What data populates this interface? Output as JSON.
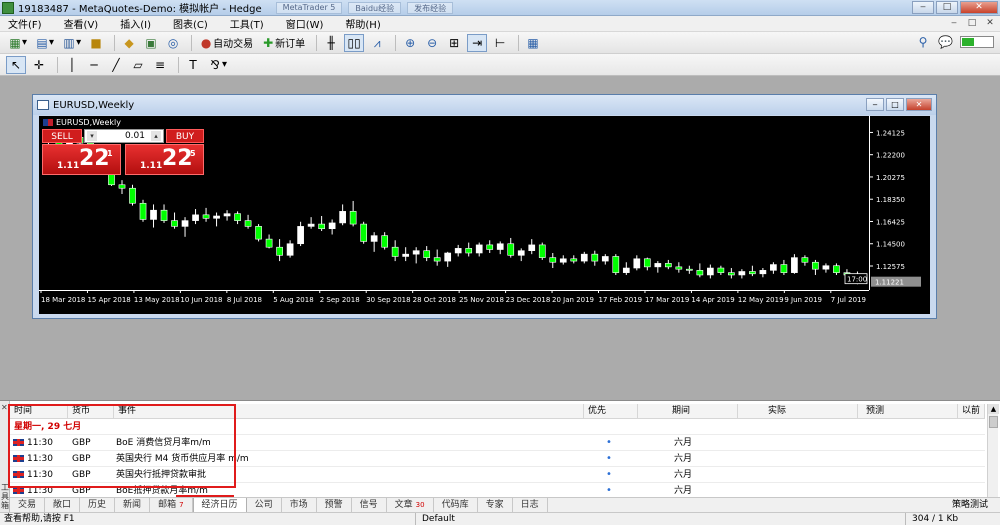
{
  "window": {
    "title": "19183487 - MetaQuotes-Demo: 模拟帐户 - Hedge",
    "background_tabs": [
      "MetaTrader 5",
      "Baidu经验",
      "发布经验"
    ],
    "btn_min": "‒",
    "btn_max": "□",
    "btn_close": "✕"
  },
  "menu": [
    "文件(F)",
    "查看(V)",
    "插入(I)",
    "图表(C)",
    "工具(T)",
    "窗口(W)",
    "帮助(H)"
  ],
  "toolbar": {
    "autotrade_label": "自动交易",
    "new_order_label": "新订单"
  },
  "chart_window": {
    "title": "EURUSD,Weekly",
    "inner_label": "EURUSD,Weekly"
  },
  "trade_panel": {
    "sell_label": "SELL",
    "buy_label": "BUY",
    "lot_value": "0.01",
    "sell_price_prefix": "1.11",
    "sell_price_big": "22",
    "sell_price_sup": "1",
    "buy_price_prefix": "1.11",
    "buy_price_big": "22",
    "buy_price_sup": "5"
  },
  "chart_data": {
    "type": "candlestick",
    "symbol": "EURUSD",
    "timeframe": "Weekly",
    "ylim": [
      1.105,
      1.252
    ],
    "y_ticks": [
      "1.24125",
      "1.22200",
      "1.20275",
      "1.18350",
      "1.16425",
      "1.14500",
      "1.12575"
    ],
    "y_tick_values": [
      1.24125,
      1.222,
      1.20275,
      1.1835,
      1.16425,
      1.145,
      1.12575
    ],
    "x_ticks": [
      "18 Mar 2018",
      "15 Apr 2018",
      "13 May 2018",
      "10 Jun 2018",
      "8 Jul 2018",
      "5 Aug 2018",
      "2 Sep 2018",
      "30 Sep 2018",
      "28 Oct 2018",
      "25 Nov 2018",
      "23 Dec 2018",
      "20 Jan 2019",
      "17 Feb 2019",
      "17 Mar 2019",
      "14 Apr 2019",
      "12 May 2019",
      "9 Jun 2019",
      "7 Jul 2019"
    ],
    "current_price": "1.11221",
    "time_label": "17:00",
    "candles": [
      {
        "o": 1.233,
        "h": 1.241,
        "l": 1.229,
        "c": 1.235
      },
      {
        "o": 1.235,
        "h": 1.24,
        "l": 1.228,
        "c": 1.23
      },
      {
        "o": 1.23,
        "h": 1.239,
        "l": 1.225,
        "c": 1.237
      },
      {
        "o": 1.237,
        "h": 1.242,
        "l": 1.23,
        "c": 1.232
      },
      {
        "o": 1.232,
        "h": 1.236,
        "l": 1.22,
        "c": 1.227
      },
      {
        "o": 1.227,
        "h": 1.23,
        "l": 1.21,
        "c": 1.212
      },
      {
        "o": 1.212,
        "h": 1.215,
        "l": 1.195,
        "c": 1.196
      },
      {
        "o": 1.196,
        "h": 1.2,
        "l": 1.188,
        "c": 1.193
      },
      {
        "o": 1.193,
        "h": 1.196,
        "l": 1.178,
        "c": 1.18
      },
      {
        "o": 1.18,
        "h": 1.183,
        "l": 1.164,
        "c": 1.166
      },
      {
        "o": 1.166,
        "h": 1.179,
        "l": 1.159,
        "c": 1.174
      },
      {
        "o": 1.174,
        "h": 1.179,
        "l": 1.163,
        "c": 1.165
      },
      {
        "o": 1.165,
        "h": 1.172,
        "l": 1.158,
        "c": 1.16
      },
      {
        "o": 1.16,
        "h": 1.168,
        "l": 1.151,
        "c": 1.165
      },
      {
        "o": 1.165,
        "h": 1.175,
        "l": 1.162,
        "c": 1.17
      },
      {
        "o": 1.17,
        "h": 1.176,
        "l": 1.164,
        "c": 1.167
      },
      {
        "o": 1.167,
        "h": 1.172,
        "l": 1.16,
        "c": 1.169
      },
      {
        "o": 1.169,
        "h": 1.174,
        "l": 1.165,
        "c": 1.171
      },
      {
        "o": 1.171,
        "h": 1.173,
        "l": 1.162,
        "c": 1.165
      },
      {
        "o": 1.165,
        "h": 1.17,
        "l": 1.158,
        "c": 1.16
      },
      {
        "o": 1.16,
        "h": 1.162,
        "l": 1.147,
        "c": 1.149
      },
      {
        "o": 1.149,
        "h": 1.153,
        "l": 1.141,
        "c": 1.142
      },
      {
        "o": 1.142,
        "h": 1.149,
        "l": 1.13,
        "c": 1.135
      },
      {
        "o": 1.135,
        "h": 1.148,
        "l": 1.133,
        "c": 1.145
      },
      {
        "o": 1.145,
        "h": 1.164,
        "l": 1.143,
        "c": 1.16
      },
      {
        "o": 1.16,
        "h": 1.168,
        "l": 1.158,
        "c": 1.162
      },
      {
        "o": 1.162,
        "h": 1.169,
        "l": 1.156,
        "c": 1.158
      },
      {
        "o": 1.158,
        "h": 1.166,
        "l": 1.153,
        "c": 1.163
      },
      {
        "o": 1.163,
        "h": 1.179,
        "l": 1.161,
        "c": 1.173
      },
      {
        "o": 1.173,
        "h": 1.182,
        "l": 1.16,
        "c": 1.162
      },
      {
        "o": 1.162,
        "h": 1.164,
        "l": 1.145,
        "c": 1.147
      },
      {
        "o": 1.147,
        "h": 1.155,
        "l": 1.138,
        "c": 1.152
      },
      {
        "o": 1.152,
        "h": 1.155,
        "l": 1.14,
        "c": 1.142
      },
      {
        "o": 1.142,
        "h": 1.148,
        "l": 1.13,
        "c": 1.134
      },
      {
        "o": 1.134,
        "h": 1.142,
        "l": 1.13,
        "c": 1.136
      },
      {
        "o": 1.136,
        "h": 1.142,
        "l": 1.128,
        "c": 1.139
      },
      {
        "o": 1.139,
        "h": 1.143,
        "l": 1.13,
        "c": 1.133
      },
      {
        "o": 1.133,
        "h": 1.14,
        "l": 1.126,
        "c": 1.13
      },
      {
        "o": 1.13,
        "h": 1.138,
        "l": 1.125,
        "c": 1.137
      },
      {
        "o": 1.137,
        "h": 1.144,
        "l": 1.134,
        "c": 1.141
      },
      {
        "o": 1.141,
        "h": 1.146,
        "l": 1.134,
        "c": 1.137
      },
      {
        "o": 1.137,
        "h": 1.146,
        "l": 1.134,
        "c": 1.144
      },
      {
        "o": 1.144,
        "h": 1.148,
        "l": 1.137,
        "c": 1.14
      },
      {
        "o": 1.14,
        "h": 1.147,
        "l": 1.136,
        "c": 1.145
      },
      {
        "o": 1.145,
        "h": 1.15,
        "l": 1.133,
        "c": 1.135
      },
      {
        "o": 1.135,
        "h": 1.141,
        "l": 1.13,
        "c": 1.139
      },
      {
        "o": 1.139,
        "h": 1.149,
        "l": 1.136,
        "c": 1.144
      },
      {
        "o": 1.144,
        "h": 1.146,
        "l": 1.131,
        "c": 1.133
      },
      {
        "o": 1.133,
        "h": 1.137,
        "l": 1.124,
        "c": 1.129
      },
      {
        "o": 1.129,
        "h": 1.135,
        "l": 1.127,
        "c": 1.132
      },
      {
        "o": 1.132,
        "h": 1.135,
        "l": 1.128,
        "c": 1.13
      },
      {
        "o": 1.13,
        "h": 1.138,
        "l": 1.128,
        "c": 1.136
      },
      {
        "o": 1.136,
        "h": 1.139,
        "l": 1.126,
        "c": 1.13
      },
      {
        "o": 1.13,
        "h": 1.136,
        "l": 1.127,
        "c": 1.134
      },
      {
        "o": 1.134,
        "h": 1.136,
        "l": 1.118,
        "c": 1.12
      },
      {
        "o": 1.12,
        "h": 1.129,
        "l": 1.118,
        "c": 1.124
      },
      {
        "o": 1.124,
        "h": 1.135,
        "l": 1.122,
        "c": 1.132
      },
      {
        "o": 1.132,
        "h": 1.133,
        "l": 1.122,
        "c": 1.125
      },
      {
        "o": 1.125,
        "h": 1.13,
        "l": 1.12,
        "c": 1.128
      },
      {
        "o": 1.128,
        "h": 1.131,
        "l": 1.123,
        "c": 1.125
      },
      {
        "o": 1.125,
        "h": 1.129,
        "l": 1.12,
        "c": 1.123
      },
      {
        "o": 1.123,
        "h": 1.126,
        "l": 1.119,
        "c": 1.122
      },
      {
        "o": 1.122,
        "h": 1.128,
        "l": 1.116,
        "c": 1.118
      },
      {
        "o": 1.118,
        "h": 1.127,
        "l": 1.115,
        "c": 1.124
      },
      {
        "o": 1.124,
        "h": 1.126,
        "l": 1.118,
        "c": 1.12
      },
      {
        "o": 1.12,
        "h": 1.124,
        "l": 1.115,
        "c": 1.118
      },
      {
        "o": 1.118,
        "h": 1.123,
        "l": 1.115,
        "c": 1.121
      },
      {
        "o": 1.121,
        "h": 1.126,
        "l": 1.117,
        "c": 1.119
      },
      {
        "o": 1.119,
        "h": 1.124,
        "l": 1.116,
        "c": 1.122
      },
      {
        "o": 1.122,
        "h": 1.129,
        "l": 1.119,
        "c": 1.127
      },
      {
        "o": 1.127,
        "h": 1.131,
        "l": 1.118,
        "c": 1.12
      },
      {
        "o": 1.12,
        "h": 1.136,
        "l": 1.119,
        "c": 1.133
      },
      {
        "o": 1.133,
        "h": 1.135,
        "l": 1.126,
        "c": 1.129
      },
      {
        "o": 1.129,
        "h": 1.131,
        "l": 1.118,
        "c": 1.123
      },
      {
        "o": 1.123,
        "h": 1.128,
        "l": 1.12,
        "c": 1.126
      },
      {
        "o": 1.126,
        "h": 1.128,
        "l": 1.118,
        "c": 1.12
      },
      {
        "o": 1.12,
        "h": 1.123,
        "l": 1.115,
        "c": 1.118
      },
      {
        "o": 1.118,
        "h": 1.121,
        "l": 1.11,
        "c": 1.1122
      }
    ]
  },
  "calendar": {
    "headers": {
      "time": "时间",
      "currency": "货币",
      "event": "事件",
      "priority": "优先",
      "period": "期间",
      "actual": "实际",
      "forecast": "预测",
      "previous": "以前"
    },
    "day_label": "星期一, 29 七月",
    "rows": [
      {
        "time": "11:30",
        "currency": "GBP",
        "event": "BoE 消费信贷月率m/m",
        "priority": "•",
        "period": "六月"
      },
      {
        "time": "11:30",
        "currency": "GBP",
        "event": "英国央行 M4 货币供应月率 m/m",
        "priority": "•",
        "period": "六月"
      },
      {
        "time": "11:30",
        "currency": "GBP",
        "event": "英国央行抵押贷款审批",
        "priority": "•",
        "period": "六月"
      },
      {
        "time": "11:30",
        "currency": "GBP",
        "event": "BoE抵押贷款月率m/m",
        "priority": "•",
        "period": "六月"
      }
    ]
  },
  "terminal": {
    "side_label": "工具箱",
    "tabs": [
      {
        "label": "交易",
        "badge": ""
      },
      {
        "label": "敞口",
        "badge": ""
      },
      {
        "label": "历史",
        "badge": ""
      },
      {
        "label": "新闻",
        "badge": ""
      },
      {
        "label": "邮箱",
        "badge": "7"
      },
      {
        "label": "经济日历",
        "badge": ""
      },
      {
        "label": "公司",
        "badge": ""
      },
      {
        "label": "市场",
        "badge": ""
      },
      {
        "label": "预警",
        "badge": ""
      },
      {
        "label": "信号",
        "badge": ""
      },
      {
        "label": "文章",
        "badge": "30"
      },
      {
        "label": "代码库",
        "badge": ""
      },
      {
        "label": "专家",
        "badge": ""
      },
      {
        "label": "日志",
        "badge": ""
      }
    ],
    "active_tab": "经济日历",
    "right_label": "策略测试"
  },
  "status": {
    "help": "查看帮助,请按 F1",
    "profile": "Default",
    "traffic": "304 / 1 Kb"
  },
  "colors": {
    "bull": "#ffffff",
    "bear": "#00ff00",
    "accent": "#d01d1d",
    "highlight": "#e01b1b"
  }
}
